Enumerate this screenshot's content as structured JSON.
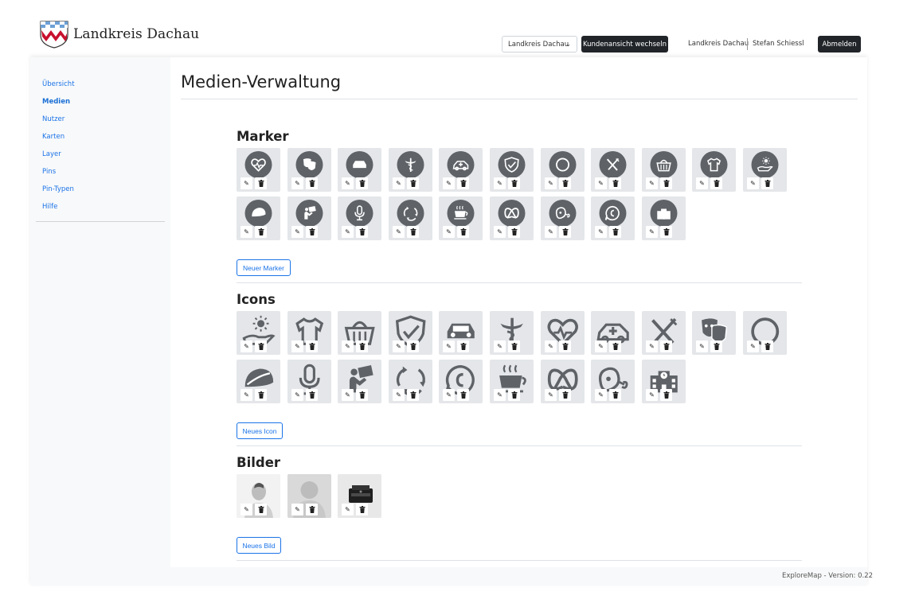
{
  "header": {
    "logo_text": "Landkreis Dachau",
    "customer_select": "Landkreis Dachau",
    "switch_label": "Kundenansicht wechseln",
    "org": "Landkreis Dachau",
    "user": "Stefan Schiessl",
    "logout_label": "Abmelden"
  },
  "sidebar": {
    "items": [
      {
        "label": "Übersicht"
      },
      {
        "label": "Medien"
      },
      {
        "label": "Nutzer"
      },
      {
        "label": "Karten"
      },
      {
        "label": "Layer"
      },
      {
        "label": "Pins"
      },
      {
        "label": "Pin-Typen"
      },
      {
        "label": "Hilfe"
      }
    ]
  },
  "page": {
    "title": "Medien-Verwaltung"
  },
  "sections": {
    "marker": {
      "title": "Marker",
      "add_label": "Neuer Marker",
      "items": [
        "heart-health-icon",
        "theater-masks-icon",
        "car-icon",
        "pharmacy-icon",
        "car-medical-icon",
        "shield-check-icon",
        "circle-icon",
        "restaurant-icon",
        "shopping-basket-icon",
        "tshirt-icon",
        "hand-sun-icon",
        "leaf-icon",
        "reading-person-icon",
        "microphone-icon",
        "recycle-icon",
        "coffee-icon",
        "pretzel-icon",
        "meat-icon",
        "speech-bubble-icon",
        "school-icon"
      ]
    },
    "icons": {
      "title": "Icons",
      "add_label": "Neues Icon",
      "items": [
        "hand-sun-icon",
        "tshirt-icon",
        "shopping-basket-icon",
        "shield-check-icon",
        "car-icon",
        "pharmacy-icon",
        "heart-health-icon",
        "car-medical-icon",
        "restaurant-icon",
        "theater-masks-icon",
        "circle-icon",
        "leaf-icon",
        "microphone-icon",
        "reading-person-icon",
        "recycle-icon",
        "speech-bubble-icon",
        "coffee-icon",
        "pretzel-icon",
        "meat-icon",
        "school-icon"
      ]
    },
    "bilder": {
      "title": "Bilder",
      "add_label": "Neues Bild",
      "items": [
        "person-photo",
        "avatar-placeholder",
        "typewriter-photo"
      ]
    }
  },
  "tile_actions": {
    "edit": "✎",
    "delete": "🗑"
  },
  "footer": {
    "text": "ExploreMap - Version: 0.22"
  },
  "colors": {
    "accent": "#1a73e8",
    "dark": "#212529",
    "tile_bg": "#e4e6e9",
    "glyph": "#5f6368"
  }
}
